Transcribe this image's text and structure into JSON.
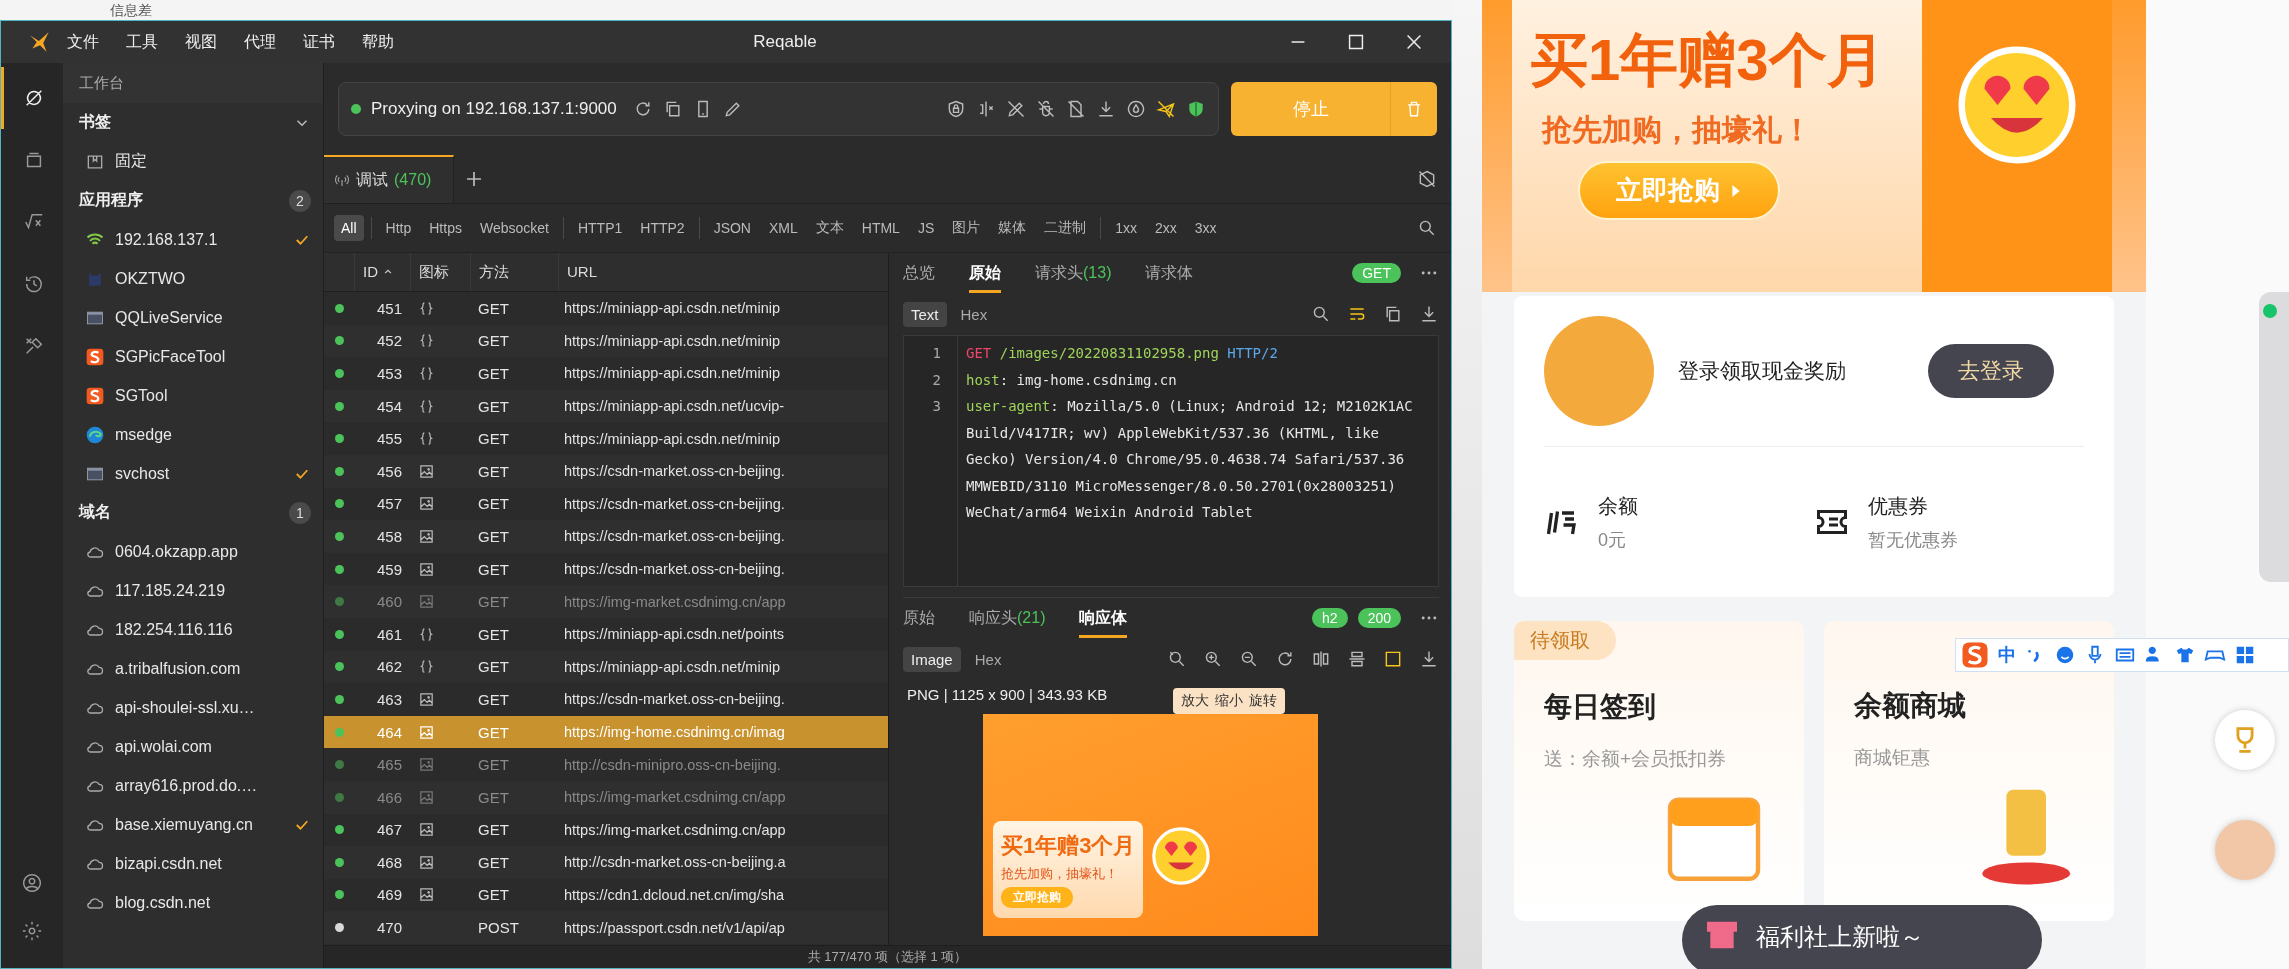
{
  "background_window": {
    "title": "信息差"
  },
  "window": {
    "title": "Reqable",
    "menu": [
      "文件",
      "工具",
      "视图",
      "代理",
      "证书",
      "帮助"
    ]
  },
  "rail_tabs": [
    {
      "selected": true
    },
    {
      "selected": false
    },
    {
      "selected": false
    },
    {
      "selected": false
    },
    {
      "selected": false
    }
  ],
  "sidebar": {
    "header": "工作台",
    "sections": [
      {
        "title": "书签",
        "kind": "collapse",
        "items": [
          {
            "label": "固定",
            "kind": "pin",
            "checked": false
          }
        ]
      },
      {
        "title": "应用程序",
        "kind": "count",
        "count": "2",
        "items": [
          {
            "label": "192.168.137.1",
            "kind": "wifi",
            "checked": true
          },
          {
            "label": "OKZTWO",
            "kind": "app",
            "checked": false
          },
          {
            "label": "QQLiveService",
            "kind": "window",
            "checked": false
          },
          {
            "label": "SGPicFaceTool",
            "kind": "sogou",
            "checked": false
          },
          {
            "label": "SGTool",
            "kind": "sogou",
            "checked": false
          },
          {
            "label": "msedge",
            "kind": "browser",
            "checked": false
          },
          {
            "label": "svchost",
            "kind": "window",
            "checked": true
          }
        ]
      },
      {
        "title": "域名",
        "kind": "count",
        "count": "1",
        "items": [
          {
            "label": "0604.okzapp.app",
            "kind": "cloud",
            "checked": false
          },
          {
            "label": "117.185.24.219",
            "kind": "cloud",
            "checked": false
          },
          {
            "label": "182.254.116.116",
            "kind": "cloud",
            "checked": false
          },
          {
            "label": "a.tribalfusion.com",
            "kind": "cloud",
            "checked": false
          },
          {
            "label": "api-shoulei-ssl.xu…",
            "kind": "cloud",
            "checked": false
          },
          {
            "label": "api.wolai.com",
            "kind": "cloud",
            "checked": false
          },
          {
            "label": "array616.prod.do.…",
            "kind": "cloud",
            "checked": false
          },
          {
            "label": "base.xiemuyang.cn",
            "kind": "cloud",
            "checked": true
          },
          {
            "label": "bizapi.csdn.net",
            "kind": "cloud",
            "checked": false
          },
          {
            "label": "blog.csdn.net",
            "kind": "cloud",
            "checked": false
          }
        ]
      }
    ]
  },
  "proxy": {
    "status": "Proxying on 192.168.137.1:9000",
    "running": true,
    "stop_label": "停止"
  },
  "tabs": [
    {
      "label": "调试",
      "count": "(470)",
      "selected": true
    }
  ],
  "filters": [
    {
      "label": "All",
      "selected": true,
      "divider_before": false
    },
    {
      "label": "Http",
      "selected": false,
      "divider_before": true
    },
    {
      "label": "Https",
      "selected": false,
      "divider_before": false
    },
    {
      "label": "Websocket",
      "selected": false,
      "divider_before": false
    },
    {
      "label": "HTTP1",
      "selected": false,
      "divider_before": true
    },
    {
      "label": "HTTP2",
      "selected": false,
      "divider_before": false
    },
    {
      "label": "JSON",
      "selected": false,
      "divider_before": true
    },
    {
      "label": "XML",
      "selected": false,
      "divider_before": false
    },
    {
      "label": "文本",
      "selected": false,
      "divider_before": false
    },
    {
      "label": "HTML",
      "selected": false,
      "divider_before": false
    },
    {
      "label": "JS",
      "selected": false,
      "divider_before": false
    },
    {
      "label": "图片",
      "selected": false,
      "divider_before": false
    },
    {
      "label": "媒体",
      "selected": false,
      "divider_before": false
    },
    {
      "label": "二进制",
      "selected": false,
      "divider_before": false
    },
    {
      "label": "1xx",
      "selected": false,
      "divider_before": true
    },
    {
      "label": "2xx",
      "selected": false,
      "divider_before": false
    },
    {
      "label": "3xx",
      "selected": false,
      "divider_before": false
    }
  ],
  "table": {
    "columns": [
      "ID",
      "图标",
      "方法",
      "URL"
    ],
    "rows": [
      {
        "id": "451",
        "kind": "json",
        "method": "GET",
        "url": "https://miniapp-api.csdn.net/minip",
        "dimmed": false,
        "selected": false,
        "color": "#4cc35a"
      },
      {
        "id": "452",
        "kind": "json",
        "method": "GET",
        "url": "https://miniapp-api.csdn.net/minip",
        "dimmed": false,
        "selected": false,
        "color": "#4cc35a"
      },
      {
        "id": "453",
        "kind": "json",
        "method": "GET",
        "url": "https://miniapp-api.csdn.net/minip",
        "dimmed": false,
        "selected": false,
        "color": "#4cc35a"
      },
      {
        "id": "454",
        "kind": "json",
        "method": "GET",
        "url": "https://miniapp-api.csdn.net/ucvip-",
        "dimmed": false,
        "selected": false,
        "color": "#4cc35a"
      },
      {
        "id": "455",
        "kind": "json",
        "method": "GET",
        "url": "https://miniapp-api.csdn.net/minip",
        "dimmed": false,
        "selected": false,
        "color": "#4cc35a"
      },
      {
        "id": "456",
        "kind": "image",
        "method": "GET",
        "url": "https://csdn-market.oss-cn-beijing.",
        "dimmed": false,
        "selected": false,
        "color": "#4cc35a"
      },
      {
        "id": "457",
        "kind": "image",
        "method": "GET",
        "url": "https://csdn-market.oss-cn-beijing.",
        "dimmed": false,
        "selected": false,
        "color": "#4cc35a"
      },
      {
        "id": "458",
        "kind": "image",
        "method": "GET",
        "url": "https://csdn-market.oss-cn-beijing.",
        "dimmed": false,
        "selected": false,
        "color": "#4cc35a"
      },
      {
        "id": "459",
        "kind": "image",
        "method": "GET",
        "url": "https://csdn-market.oss-cn-beijing.",
        "dimmed": false,
        "selected": false,
        "color": "#4cc35a"
      },
      {
        "id": "460",
        "kind": "image",
        "method": "GET",
        "url": "https://img-market.csdnimg.cn/app",
        "dimmed": true,
        "selected": false,
        "color": "#3f7a45"
      },
      {
        "id": "461",
        "kind": "json",
        "method": "GET",
        "url": "https://miniapp-api.csdn.net/points",
        "dimmed": false,
        "selected": false,
        "color": "#4cc35a"
      },
      {
        "id": "462",
        "kind": "json",
        "method": "GET",
        "url": "https://miniapp-api.csdn.net/minip",
        "dimmed": false,
        "selected": false,
        "color": "#4cc35a"
      },
      {
        "id": "463",
        "kind": "image",
        "method": "GET",
        "url": "https://csdn-market.oss-cn-beijing.",
        "dimmed": false,
        "selected": false,
        "color": "#4cc35a"
      },
      {
        "id": "464",
        "kind": "image",
        "method": "GET",
        "url": "https://img-home.csdnimg.cn/imag",
        "dimmed": false,
        "selected": true,
        "color": "#4cc35a"
      },
      {
        "id": "465",
        "kind": "image",
        "method": "GET",
        "url": "http://csdn-minipro.oss-cn-beijing.",
        "dimmed": true,
        "selected": false,
        "color": "#3f7a45"
      },
      {
        "id": "466",
        "kind": "image",
        "method": "GET",
        "url": "https://img-market.csdnimg.cn/app",
        "dimmed": true,
        "selected": false,
        "color": "#3f7a45"
      },
      {
        "id": "467",
        "kind": "image",
        "method": "GET",
        "url": "https://img-market.csdnimg.cn/app",
        "dimmed": false,
        "selected": false,
        "color": "#4cc35a"
      },
      {
        "id": "468",
        "kind": "image",
        "method": "GET",
        "url": "http://csdn-market.oss-cn-beijing.a",
        "dimmed": false,
        "selected": false,
        "color": "#4cc35a"
      },
      {
        "id": "469",
        "kind": "image",
        "method": "GET",
        "url": "https://cdn1.dcloud.net.cn/img/sha",
        "dimmed": false,
        "selected": false,
        "color": "#4cc35a"
      },
      {
        "id": "470",
        "kind": "none",
        "method": "POST",
        "url": "https://passport.csdn.net/v1/api/ap",
        "dimmed": false,
        "selected": false,
        "color": "#d8d8d8"
      }
    ]
  },
  "request": {
    "tabs": [
      {
        "label": "总览",
        "selected": false
      },
      {
        "label": "原始",
        "selected": true
      },
      {
        "label": "请求头",
        "count": "(13)",
        "selected": false
      },
      {
        "label": "请求体",
        "selected": false
      }
    ],
    "method_badge": "GET",
    "views": [
      {
        "label": "Text",
        "selected": true
      },
      {
        "label": "Hex",
        "selected": false
      }
    ],
    "lines": [
      {
        "number": "1",
        "parts": [
          {
            "kind": "method",
            "text": "GET "
          },
          {
            "kind": "path",
            "text": "/images/20220831102958.png "
          },
          {
            "kind": "proto",
            "text": "HTTP/2"
          }
        ]
      },
      {
        "number": "2",
        "parts": [
          {
            "kind": "key",
            "text": "host"
          },
          {
            "kind": "plain",
            "text": ": img-home.csdnimg.cn"
          }
        ]
      },
      {
        "number": "3",
        "parts": [
          {
            "kind": "key",
            "text": "user-agent"
          },
          {
            "kind": "plain",
            "text": ": Mozilla/5.0 (Linux; Android 12; M2102K1AC Build/V417IR; wv) AppleWebKit/537.36 (KHTML, like Gecko) Version/4.0 Chrome/95.0.4638.74 Safari/537.36 MMWEBID/3110 MicroMessenger/8.0.50.2701(0x28003251) WeChat/arm64 Weixin Android Tablet"
          }
        ]
      }
    ]
  },
  "response": {
    "tabs": [
      {
        "label": "原始",
        "selected": false
      },
      {
        "label": "响应头",
        "count": "(21)",
        "selected": false
      },
      {
        "label": "响应体",
        "selected": true
      }
    ],
    "badges": [
      "h2",
      "200"
    ],
    "views": [
      {
        "label": "Image",
        "selected": true
      },
      {
        "label": "Hex",
        "selected": false
      }
    ],
    "image_info": "PNG | 1125 x 900 | 343.93 KB",
    "tooltip": [
      "放大",
      "缩小",
      "旋转"
    ],
    "preview": {
      "headline": "买1年赠3个月",
      "subline": "抢先加购，抽壕礼！",
      "button": "立即抢购"
    }
  },
  "status_bar": "共 177/470 项（选择 1 项）",
  "page": {
    "banner": {
      "headline": "买1年赠3个月",
      "subline": "抢先加购，抽壕礼！",
      "button": "立即抢购"
    },
    "login_text": "登录领取现金奖励",
    "login_button": "去登录",
    "stats": [
      {
        "label": "余额",
        "value": "0元",
        "kind": "balance"
      },
      {
        "label": "优惠券",
        "value": "暂无优惠券",
        "kind": "coupon"
      }
    ],
    "cards": [
      {
        "badge": "待领取",
        "title": "每日签到",
        "subtitle": "送：余额+会员抵扣券"
      },
      {
        "title": "余额商城",
        "subtitle": "商城钜惠"
      }
    ],
    "float_bar": "福利社上新啦～"
  },
  "ime": {
    "mode": "中"
  }
}
